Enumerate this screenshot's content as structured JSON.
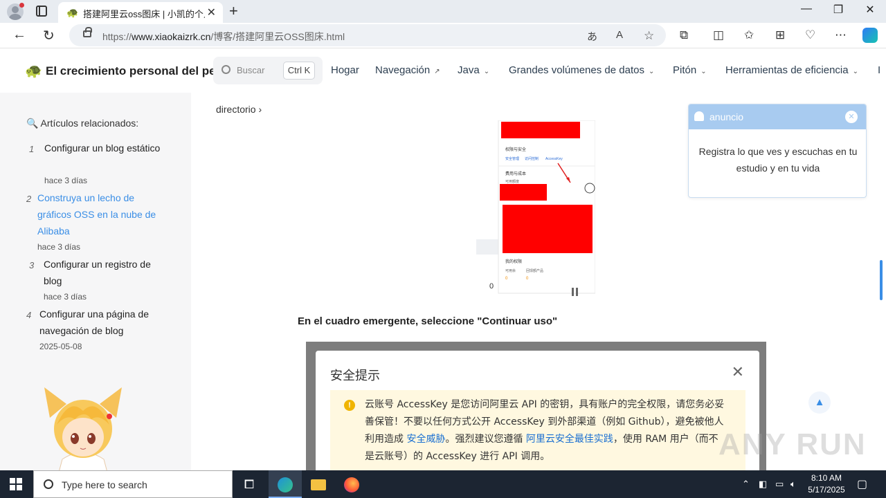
{
  "browser": {
    "tab_title": "搭建阿里云oss图床 | 小凯的个人成长",
    "tab_favicon": "🐢",
    "url_prefix": "https://",
    "url_domain": "www.xiaokaizrk.cn",
    "url_path": "/博客/搭建阿里云OSS图床.html"
  },
  "site": {
    "title": "El crecimiento personal del pequeño Kai",
    "logo": "🐢",
    "search_placeholder": "Buscar",
    "search_shortcut": "Ctrl K",
    "menu": [
      {
        "label": "Hogar",
        "caret": ""
      },
      {
        "label": "Navegación",
        "caret": "↗"
      },
      {
        "label": "Java",
        "caret": "⌄"
      },
      {
        "label": "Grandes volúmenes de datos",
        "caret": "⌄"
      },
      {
        "label": "Pitón",
        "caret": "⌄"
      },
      {
        "label": "Herramientas de eficiencia",
        "caret": "⌄"
      },
      {
        "label": "I",
        "caret": ""
      }
    ]
  },
  "sidebar": {
    "title": "🔍 Artículos relacionados:",
    "items": [
      {
        "num": "1",
        "title": "Configurar un blog estático",
        "date": "hace 3 días"
      },
      {
        "num": "2",
        "title": "Construya un lecho de gráficos OSS en la nube de Alibaba",
        "date": "hace 3 días"
      },
      {
        "num": "3",
        "title": "Configurar un registro de blog",
        "date": "hace 3 días"
      },
      {
        "num": "4",
        "title": "Configurar una página de navegación de blog",
        "date": "2025-05-08"
      }
    ]
  },
  "content": {
    "breadcrumb": "directorio",
    "shot1_items": {
      "perm_title": "权限与安全",
      "link1": "安全管理",
      "link2": "访问控制",
      "link3": "AccessKey",
      "cost_title": "费用与成本",
      "cost_sub": "可用额度",
      "orders_title": "我的权限",
      "col1": "可用余",
      "col2": "回馈额产品",
      "val1": "0",
      "val2": "0",
      "zero": "0"
    },
    "caption": "En el cuadro emergente, seleccione \"Continuar uso\"",
    "dialog": {
      "title": "安全提示",
      "text_1": "云账号 AccessKey 是您访问阿里云 API 的密钥，具有账户的完全权限，请您务必妥善保管！不要以任何方式公开 AccessKey 到外部渠道（例如 Github），避免被他人利用造成 ",
      "link_1": "安全威胁",
      "text_2": "。强烈建议您遵循 ",
      "link_2": "阿里云安全最佳实践",
      "text_3": "，使用 RAM 用户（而不是云账号）的 AccessKey 进行 API 调用。"
    }
  },
  "notice": {
    "title": "anuncio",
    "body": "Registra lo que ves y escuchas en tu estudio y en tu vida"
  },
  "watermark": "ANY RUN",
  "taskbar": {
    "search_placeholder": "Type here to search",
    "time": "8:10 AM",
    "date": "5/17/2025"
  }
}
